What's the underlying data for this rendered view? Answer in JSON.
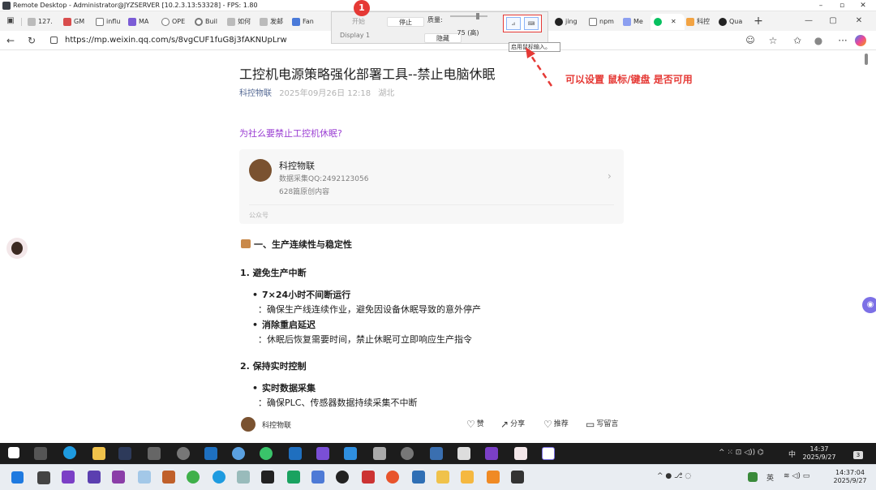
{
  "window": {
    "title": "Remote Desktop - Administrator@JYZSERVER [10.2.3.13:53328] - FPS: 1.80",
    "min": "–",
    "max": "▫",
    "close": "✕"
  },
  "browser": {
    "tabs": [
      {
        "label": "127."
      },
      {
        "label": "GM"
      },
      {
        "label": "influ"
      },
      {
        "label": "MA"
      },
      {
        "label": "OPE"
      },
      {
        "label": "Buil"
      },
      {
        "label": "如何"
      },
      {
        "label": "发邮"
      },
      {
        "label": "Fan"
      },
      {
        "label": "jing"
      },
      {
        "label": "npm"
      },
      {
        "label": "Me"
      },
      {
        "label": "科控"
      },
      {
        "label": "Qua"
      }
    ],
    "active_tab_close": "✕",
    "new_tab": "+",
    "url": "https://mp.weixin.qq.com/s/8vgCUF1fuG8j3fAKNUpLrw",
    "back": "←",
    "refresh": "↻",
    "win_min": "—",
    "win_max": "▢",
    "win_close": "✕"
  },
  "rdp_toolbar": {
    "badge": "1",
    "start": "开始",
    "stop": "停止",
    "display": "Display 1",
    "hide": "隐藏",
    "quality_label": "质量:",
    "quality_value": "75 (高)",
    "mouse_tooltip": "启用鼠标输入。"
  },
  "annotation": {
    "text": "可以设置 鼠标/键盘 是否可用",
    "color": "#e53935"
  },
  "article": {
    "title": "工控机电源策略强化部署工具--禁止电脑休眠",
    "account": "科控物联",
    "date": "2025年09月26日 12:18",
    "location": "湖北",
    "question": "为社么要禁止工控机休眠?",
    "card": {
      "name": "科控物联",
      "line1": "数据采集QQ:2492123056",
      "line2": "628篇原创内容",
      "tag": "公众号",
      "chevron": "›"
    },
    "section1": "一、生产连续性与稳定性",
    "sub1": "1. 避免生产中断",
    "bullet1_title": "7×24小时不间断运行",
    "bullet1_desc": "：确保生产线连续作业，避免因设备休眠导致的意外停产",
    "bullet2_title": "消除重启延迟",
    "bullet2_desc": "：休眠后恢复需要时间，禁止休眠可立即响应生产指令",
    "sub2": "2. 保持实时控制",
    "bullet3_title": "实时数据采集",
    "bullet3_desc": "：确保PLC、传感器数据持续采集不中断"
  },
  "bottom": {
    "name": "科控物联",
    "like": "赞",
    "share": "分享",
    "recommend": "推荐",
    "comment": "写留言"
  },
  "remote_taskbar": {
    "time": "14:37",
    "date": "2025/9/27",
    "ime": "中",
    "notif": "3"
  },
  "local_taskbar": {
    "time": "14:37:04",
    "date": "2025/9/27",
    "ime": "英"
  },
  "colors": {
    "accent_link": "#576b95",
    "question": "#9b3fd3",
    "taskbar_dark": "#1c1c1c"
  }
}
